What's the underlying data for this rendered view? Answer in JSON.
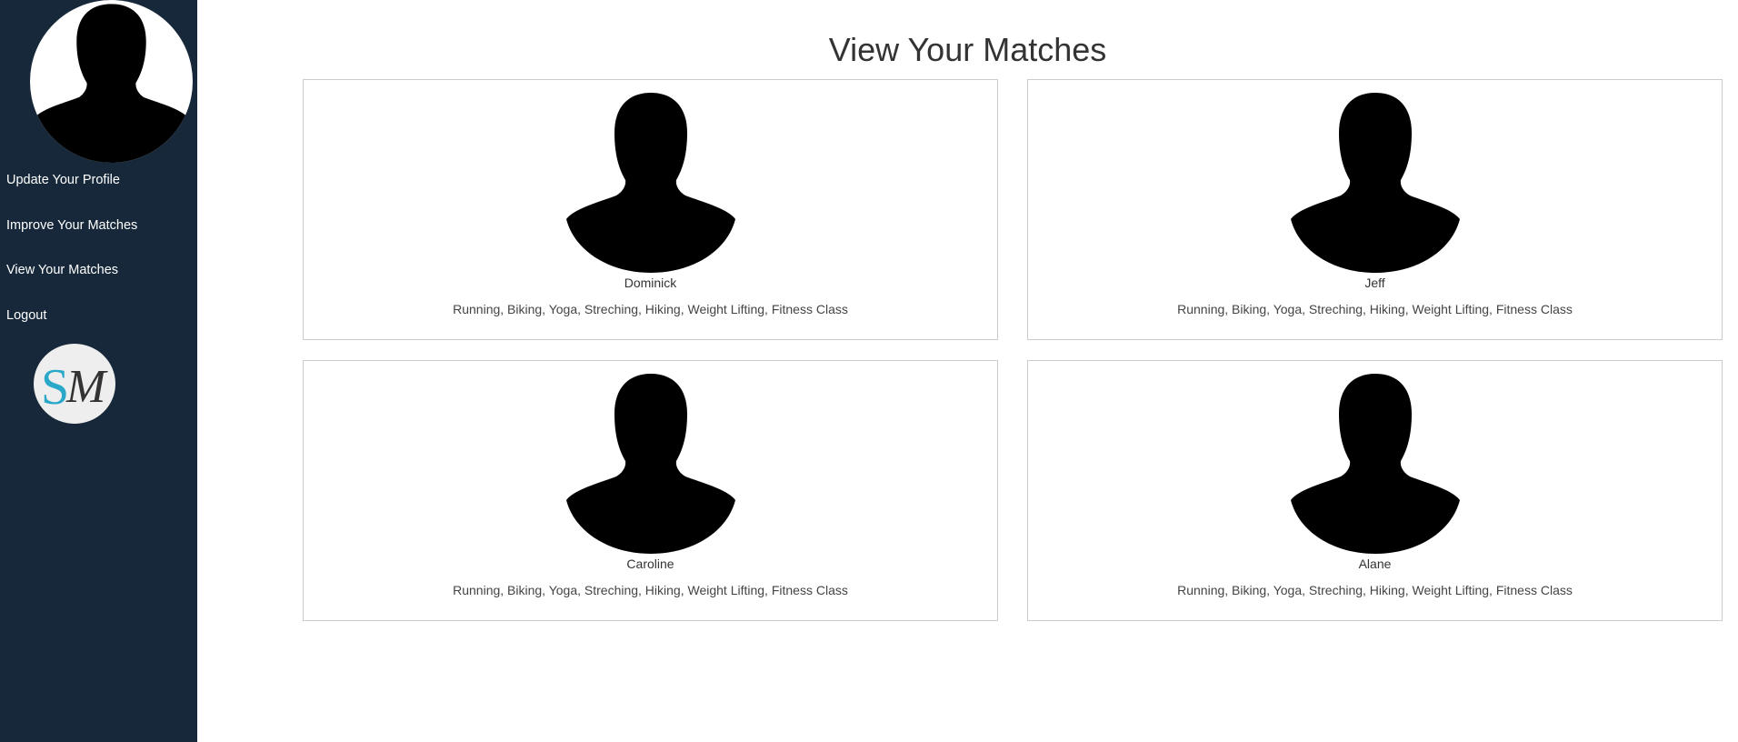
{
  "sidebar": {
    "avatar_icon": "person-silhouette-icon",
    "nav": [
      {
        "label": "Update Your Profile"
      },
      {
        "label": "Improve Your Matches"
      },
      {
        "label": "View Your Matches"
      },
      {
        "label": "Logout"
      }
    ],
    "logo": {
      "letters": "SM",
      "colors": {
        "s": "#29a8c9",
        "m": "#333333"
      }
    }
  },
  "main": {
    "title": "View Your Matches",
    "matches": [
      {
        "name": "Dominick",
        "interests": "Running, Biking, Yoga, Streching, Hiking, Weight Lifting, Fitness Class",
        "avatar_icon": "person-silhouette-icon"
      },
      {
        "name": "Jeff",
        "interests": "Running, Biking, Yoga, Streching, Hiking, Weight Lifting, Fitness Class",
        "avatar_icon": "person-silhouette-icon"
      },
      {
        "name": "Caroline",
        "interests": "Running, Biking, Yoga, Streching, Hiking, Weight Lifting, Fitness Class",
        "avatar_icon": "person-silhouette-icon"
      },
      {
        "name": "Alane",
        "interests": "Running, Biking, Yoga, Streching, Hiking, Weight Lifting, Fitness Class",
        "avatar_icon": "person-silhouette-icon"
      }
    ]
  },
  "colors": {
    "sidebar_bg": "#16283a",
    "nav_text": "#ffffff",
    "card_border": "#cccccc",
    "title_text": "#333333"
  }
}
